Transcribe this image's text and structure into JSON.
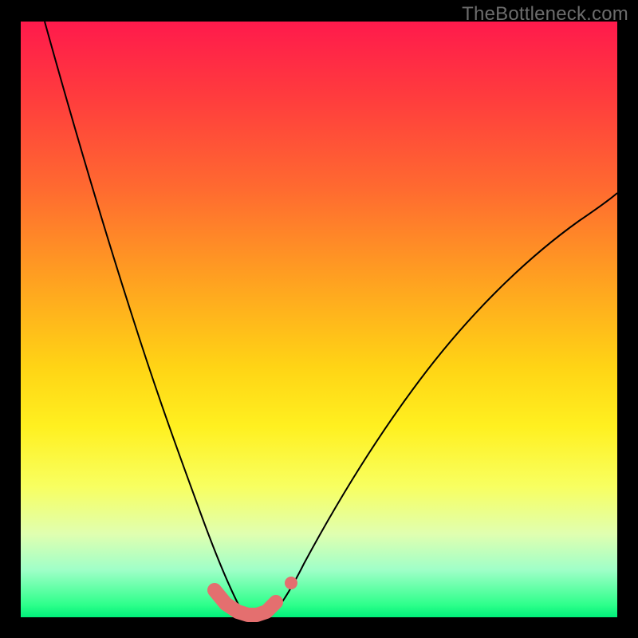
{
  "watermark": "TheBottleneck.com",
  "chart_data": {
    "type": "line",
    "title": "",
    "xlabel": "",
    "ylabel": "",
    "xlim": [
      0,
      100
    ],
    "ylim": [
      0,
      100
    ],
    "series": [
      {
        "name": "curve-left",
        "x": [
          4,
          8,
          12,
          16,
          20,
          24,
          26,
          28,
          30,
          31,
          32,
          33,
          34,
          35,
          36,
          37,
          38
        ],
        "y": [
          100,
          86,
          72,
          58,
          44,
          30,
          22,
          15,
          9,
          6.5,
          4.5,
          3,
          2,
          1.2,
          0.8,
          0.5,
          0.4
        ]
      },
      {
        "name": "curve-right",
        "x": [
          42,
          44,
          46,
          50,
          55,
          60,
          65,
          70,
          75,
          80,
          85,
          90,
          95,
          100
        ],
        "y": [
          0.5,
          1.2,
          3,
          8,
          17,
          27,
          36,
          44,
          51,
          57,
          62,
          66,
          69.5,
          72
        ]
      },
      {
        "name": "bottleneck-markers",
        "x": [
          32,
          33,
          34,
          35,
          36,
          37,
          38,
          39,
          40,
          41,
          42,
          43,
          44,
          45,
          46
        ],
        "y": [
          3,
          2,
          1.3,
          0.8,
          0.5,
          0.4,
          0.4,
          0.4,
          0.4,
          0.5,
          0.8,
          1.3,
          2,
          3,
          5
        ]
      }
    ],
    "background_gradient": {
      "stops": [
        {
          "pos": 0,
          "color": "#ff1a4c"
        },
        {
          "pos": 28,
          "color": "#ff6a30"
        },
        {
          "pos": 58,
          "color": "#ffd415"
        },
        {
          "pos": 78,
          "color": "#f8ff60"
        },
        {
          "pos": 92,
          "color": "#a0ffc8"
        },
        {
          "pos": 100,
          "color": "#00f07a"
        }
      ]
    }
  }
}
